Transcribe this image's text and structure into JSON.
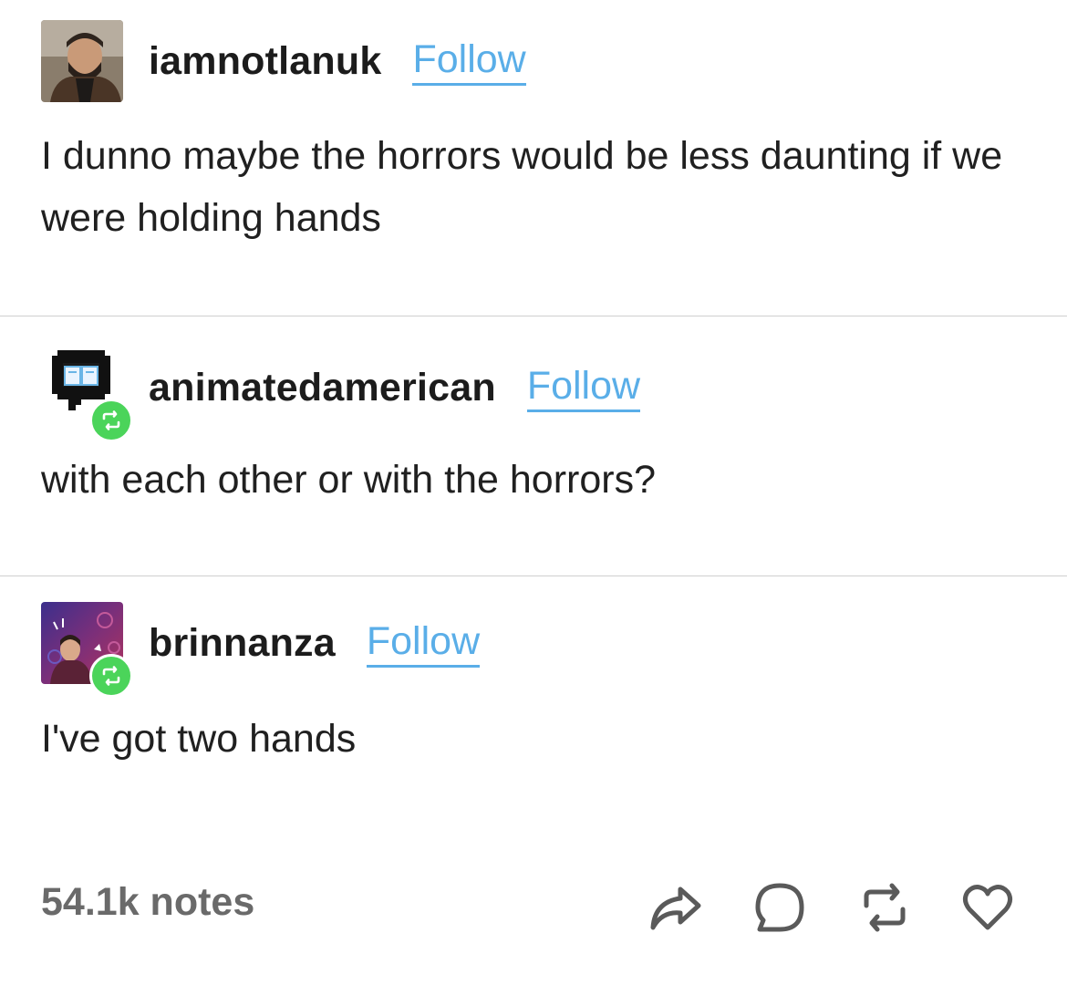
{
  "posts": [
    {
      "username": "iamnotlanuk",
      "follow_label": "Follow",
      "text": "I dunno maybe the horrors would be less daunting if we were holding hands"
    },
    {
      "username": "animatedamerican",
      "follow_label": "Follow",
      "text": "with each other or with the horrors?"
    },
    {
      "username": "brinnanza",
      "follow_label": "Follow",
      "text": "I've got two hands"
    }
  ],
  "footer": {
    "notes": "54.1k notes",
    "actions": [
      "share-icon",
      "comment-icon",
      "reblog-icon",
      "heart-icon"
    ]
  },
  "colors": {
    "follow": "#5aaee8",
    "reblog_badge": "#4bd45a",
    "divider": "#cfcfcf",
    "notes_text": "#6a6a6a"
  }
}
